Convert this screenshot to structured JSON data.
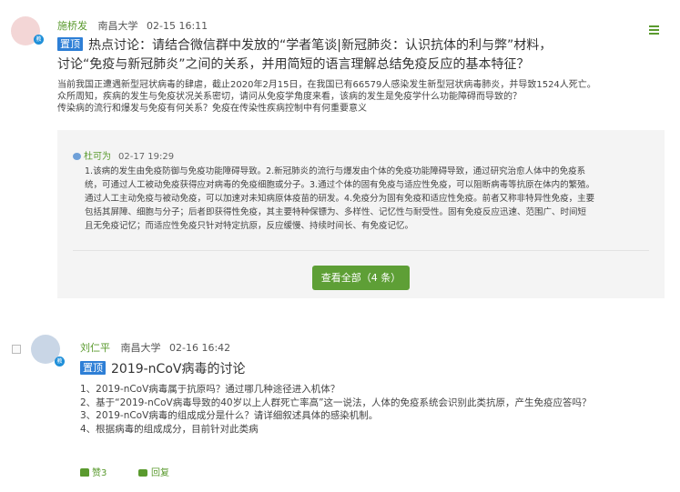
{
  "post1": {
    "avatar_badge": "教",
    "author": "施桥发",
    "school": "南昌大学",
    "time": "02-15 16:11",
    "pin_label": "置顶",
    "title_line1": "热点讨论：请结合微信群中发放的“学者笔谈|新冠肺炎：认识抗体的利与弊”材料，",
    "title_line2": "讨论“免疫与新冠肺炎”之间的关系，并用简短的语言理解总结免疫反应的基本特征？",
    "body_lines": [
      "当前我国正遭遇新型冠状病毒的肆虐，截止2020年2月15日，在我国已有66579人感染发生新型冠状病毒肺炎，并导致1524人死亡。",
      "众所周知，疾病的发生与免疫状况关系密切，请问从免疫学角度来看，该病的发生是免疫学什么功能障碍而导致的？",
      "传染病的流行和爆发与免疫有何关系？免疫在传染性疾病控制中有何重要意义"
    ],
    "reply": {
      "author": "杜可为",
      "time": "02-17 19:29",
      "lines": [
        "1.该病的发生由免疫防御与免疫功能障碍导致。2.新冠肺炎的流行与爆发由个体的免疫功能障碍导致，通过研究治愈人体中的免疫系",
        "统，可通过人工被动免疫获得应对病毒的免疫细胞或分子。3.通过个体的固有免疫与适应性免疫，可以阻断病毒等抗原在体内的繁殖。",
        "通过人工主动免疫与被动免疫，可以加速对未知病原体疫苗的研发。4.免疫分为固有免疫和适应性免疫。前者又称非特异性免疫，主要",
        "包括其屏障、细胞与分子；后者即获得性免疫，其主要特种保镖为、多样性、记忆性与耐受性。固有免疫反应迅速、范围广、时间短",
        "且无免疫记忆；而适应性免疫只针对特定抗原，反应缓慢、持续时间长、有免疫记忆。"
      ]
    },
    "view_all_label": "查看全部（4 条）"
  },
  "post2": {
    "avatar_badge": "教",
    "author": "刘仁平",
    "school": "南昌大学",
    "time": "02-16 16:42",
    "pin_label": "置顶",
    "title": "2019-nCoV病毒的讨论",
    "body_lines": [
      "1、2019-nCoV病毒属于抗原吗？通过哪几种途径进入机体？",
      "2、基于“2019-nCoV病毒导致的40岁以上人群死亡率高”这一说法，人体的免疫系统会识别此类抗原，产生免疫应答吗？",
      "3、2019-nCoV病毒的组成成分是什么？请详细叙述具体的感染机制。",
      "4、根据病毒的组成成分，目前针对此类病"
    ],
    "like_label": "赞3",
    "comment_label": "回复"
  },
  "icons": {
    "menu": "hamburger-menu-icon",
    "like": "thumbs-up-icon",
    "comment": "comment-icon"
  },
  "colors": {
    "accent_green": "#5e9f36",
    "pin_blue": "#2e7fd6"
  }
}
